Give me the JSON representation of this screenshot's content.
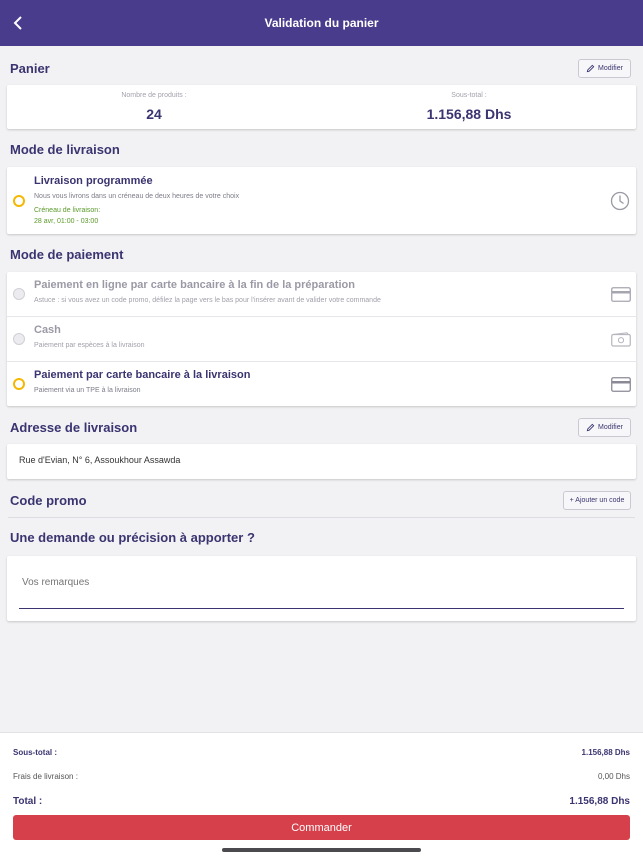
{
  "header": {
    "title": "Validation du panier"
  },
  "panier": {
    "section_title": "Panier",
    "modify_label": "Modifier",
    "products_label": "Nombre de produits :",
    "products_value": "24",
    "subtotal_label": "Sous-total :",
    "subtotal_value": "1.156,88 Dhs"
  },
  "livraison": {
    "section_title": "Mode de livraison",
    "option_title": "Livraison programmée",
    "option_desc": "Nous vous livrons dans un créneau de deux heures de votre choix",
    "slot_label": "Créneau de livraison:",
    "slot_value": "28 avr, 01:00 - 03:00"
  },
  "paiement": {
    "section_title": "Mode de paiement",
    "options": [
      {
        "title": "Paiement en ligne par carte bancaire à la fin de la préparation",
        "desc": "Astuce : si vous avez un code promo, défilez la page vers le bas pour l'insérer avant de valider votre commande",
        "selected": false
      },
      {
        "title": "Cash",
        "desc": "Paiement par espèces à la livraison",
        "selected": false
      },
      {
        "title": "Paiement par carte bancaire à la livraison",
        "desc": "Paiement via un TPE à la livraison",
        "selected": true
      }
    ]
  },
  "adresse": {
    "section_title": "Adresse de livraison",
    "modify_label": "Modifier",
    "value": "Rue d'Evian, N° 6, Assoukhour Assawda"
  },
  "promo": {
    "section_title": "Code promo",
    "add_label": "+ Ajouter un code"
  },
  "remarques": {
    "section_title": "Une demande ou précision à apporter ?",
    "placeholder": "Vos remarques"
  },
  "totals": {
    "subtotal_label": "Sous-total :",
    "subtotal_value": "1.156,88 Dhs",
    "delivery_label": "Frais de livraison :",
    "delivery_value": "0,00 Dhs",
    "total_label": "Total :",
    "total_value": "1.156,88 Dhs"
  },
  "order_button": "Commander",
  "colors": {
    "header_bg": "#4a3c8c",
    "text_primary": "#3a3470",
    "radio_selected": "#f5b800",
    "slot_green": "#5a9a2a",
    "order_button": "#d6404b"
  },
  "icons": [
    "chevron-left-icon",
    "pencil-icon",
    "clock-icon",
    "credit-card-icon",
    "cash-icon"
  ]
}
